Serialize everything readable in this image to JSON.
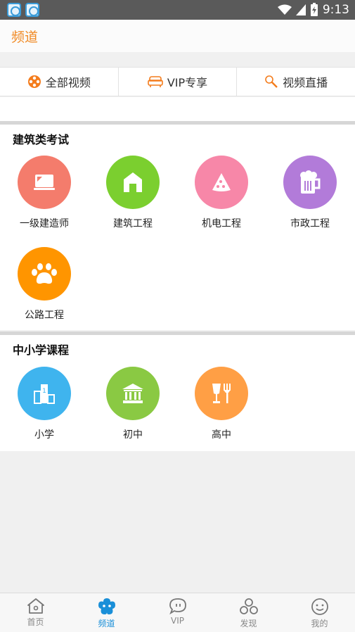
{
  "status_bar": {
    "time": "9:13"
  },
  "header": {
    "title": "频道"
  },
  "tabs": [
    {
      "label": "全部视频",
      "icon": "film-reel-icon"
    },
    {
      "label": "VIP专享",
      "icon": "sofa-icon"
    },
    {
      "label": "视频直播",
      "icon": "microphone-icon"
    }
  ],
  "sections": [
    {
      "title": "建筑类考试",
      "items": [
        {
          "label": "一级建造师",
          "icon": "laptop-icon",
          "color": "#f47c6c"
        },
        {
          "label": "建筑工程",
          "icon": "house-icon",
          "color": "#7bcf2f"
        },
        {
          "label": "机电工程",
          "icon": "pizza-icon",
          "color": "#f787a8"
        },
        {
          "label": "市政工程",
          "icon": "beer-mug-icon",
          "color": "#b27bd9"
        },
        {
          "label": "公路工程",
          "icon": "paw-icon",
          "color": "#ff9500"
        }
      ]
    },
    {
      "title": "中小学课程",
      "items": [
        {
          "label": "小学",
          "icon": "podium-icon",
          "color": "#3fb4ee"
        },
        {
          "label": "初中",
          "icon": "museum-icon",
          "color": "#8ac943"
        },
        {
          "label": "高中",
          "icon": "drink-fork-icon",
          "color": "#ff9f45"
        }
      ]
    }
  ],
  "bottom_nav": [
    {
      "label": "首页",
      "icon": "home-icon"
    },
    {
      "label": "频道",
      "icon": "channel-flower-icon",
      "active": true
    },
    {
      "label": "VIP",
      "icon": "chat-bubble-icon"
    },
    {
      "label": "发现",
      "icon": "three-circles-icon"
    },
    {
      "label": "我的",
      "icon": "smiley-icon"
    }
  ],
  "colors": {
    "accent": "#f08a24",
    "nav_active": "#1a8fd8"
  }
}
